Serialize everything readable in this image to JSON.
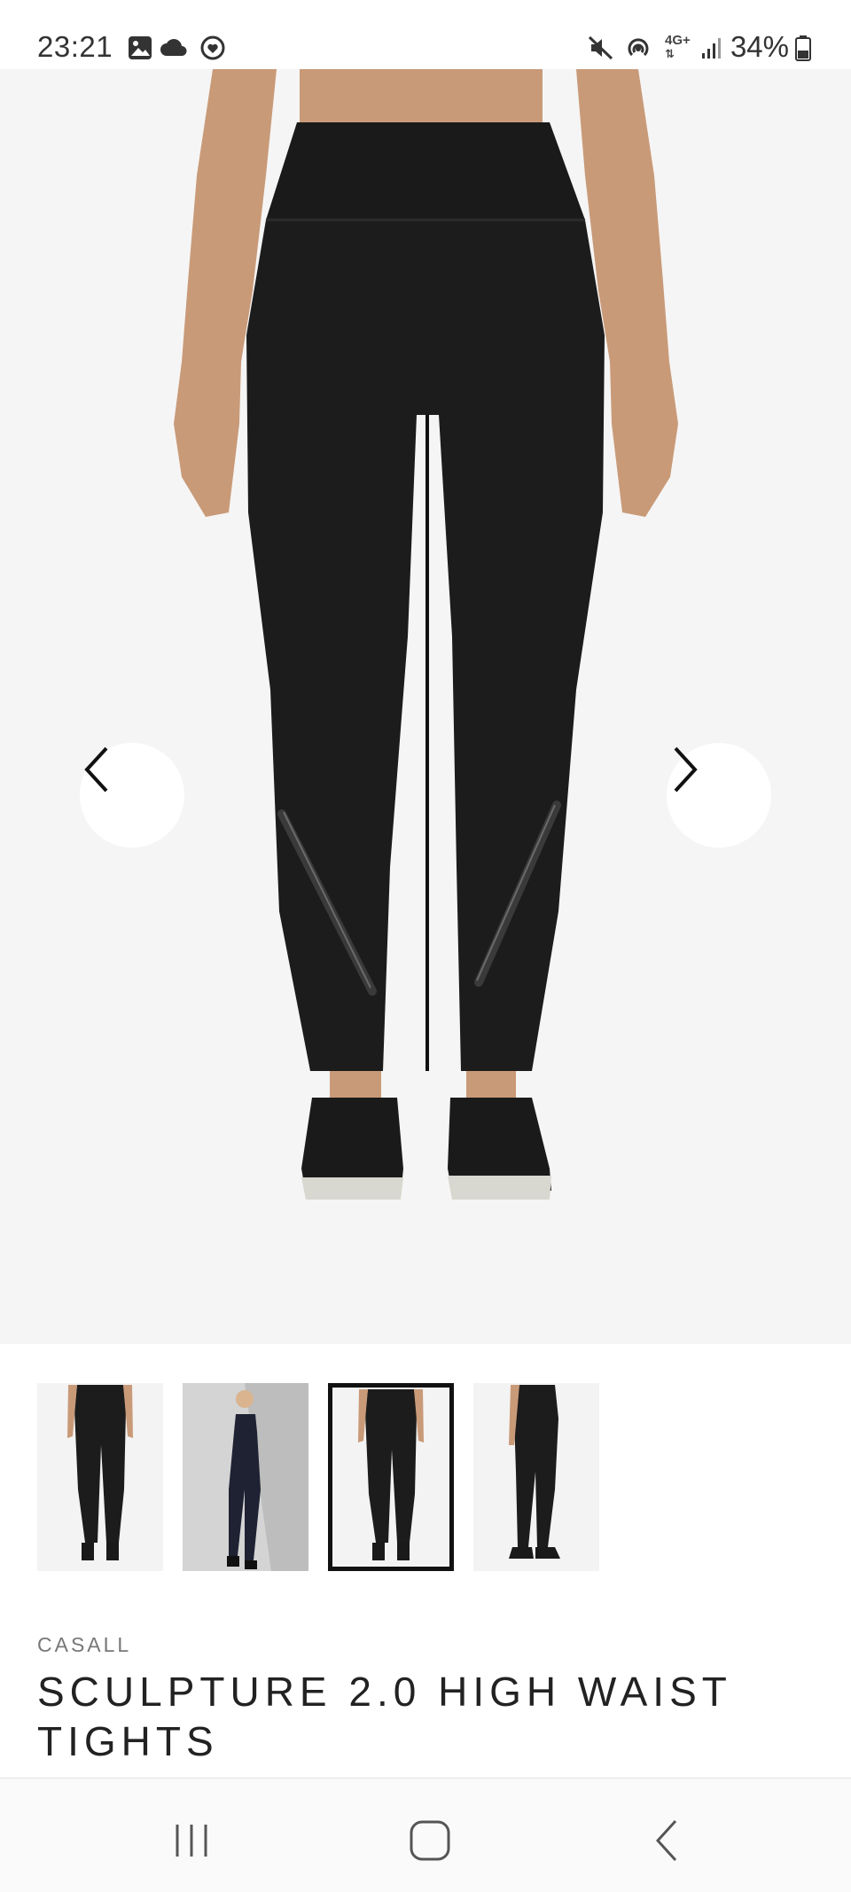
{
  "status_bar": {
    "time": "23:21",
    "battery": "34%",
    "network": "4G+",
    "icons_left": [
      "gallery-icon",
      "cloud-icon",
      "health-icon"
    ],
    "icons_right": [
      "mute-icon",
      "hotspot-icon",
      "network-4g-icon",
      "signal-icon",
      "battery-icon"
    ]
  },
  "gallery": {
    "prev_label": "Previous image",
    "next_label": "Next image",
    "active_index": 2,
    "thumbnails": [
      {
        "alt": "Tights front view"
      },
      {
        "alt": "Model wearing tights"
      },
      {
        "alt": "Tights back view"
      },
      {
        "alt": "Tights side view"
      }
    ]
  },
  "product": {
    "brand": "CASALL",
    "title": "SCULPTURE 2.0 HIGH WAIST TIGHTS"
  },
  "system_nav": {
    "recents": "recent-apps-icon",
    "home": "home-icon",
    "back": "back-icon"
  },
  "colors": {
    "garment": "#1c1c1c",
    "skin": "#c99a78",
    "background": "#f5f5f5",
    "active_border": "#111111"
  }
}
